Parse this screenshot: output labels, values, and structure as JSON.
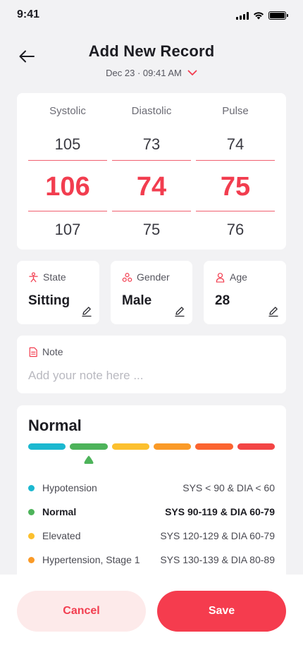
{
  "status_bar": {
    "time": "9:41"
  },
  "header": {
    "title": "Add New Record",
    "date": "Dec 23 · 09:41 AM"
  },
  "picker": {
    "columns": [
      {
        "label": "Systolic",
        "prev": "105",
        "selected": "106",
        "next": "107"
      },
      {
        "label": "Diastolic",
        "prev": "73",
        "selected": "74",
        "next": "75"
      },
      {
        "label": "Pulse",
        "prev": "74",
        "selected": "75",
        "next": "76"
      }
    ]
  },
  "info": {
    "state": {
      "label": "State",
      "value": "Sitting"
    },
    "gender": {
      "label": "Gender",
      "value": "Male"
    },
    "age": {
      "label": "Age",
      "value": "28"
    }
  },
  "note": {
    "label": "Note",
    "placeholder": "Add your note here ...",
    "value": ""
  },
  "status": {
    "title": "Normal",
    "scale_colors": [
      "#1bb8d0",
      "#4db35a",
      "#fcc02e",
      "#fa9a27",
      "#fb6430",
      "#f34545"
    ],
    "active_segment_index": 1,
    "legend": [
      {
        "name": "Hypotension",
        "range": "SYS < 90 & DIA < 60",
        "color": "#1bb8d0",
        "active": false
      },
      {
        "name": "Normal",
        "range": "SYS 90-119 & DIA 60-79",
        "color": "#4db35a",
        "active": true
      },
      {
        "name": "Elevated",
        "range": "SYS 120-129 & DIA 60-79",
        "color": "#fcc02e",
        "active": false
      },
      {
        "name": "Hypertension, Stage 1",
        "range": "SYS 130-139 & DIA 80-89",
        "color": "#fa9a27",
        "active": false
      }
    ]
  },
  "actions": {
    "cancel": "Cancel",
    "save": "Save"
  },
  "colors": {
    "accent": "#f23d4f",
    "accent_soft": "#fdeaea",
    "background": "#f2f2f4"
  }
}
